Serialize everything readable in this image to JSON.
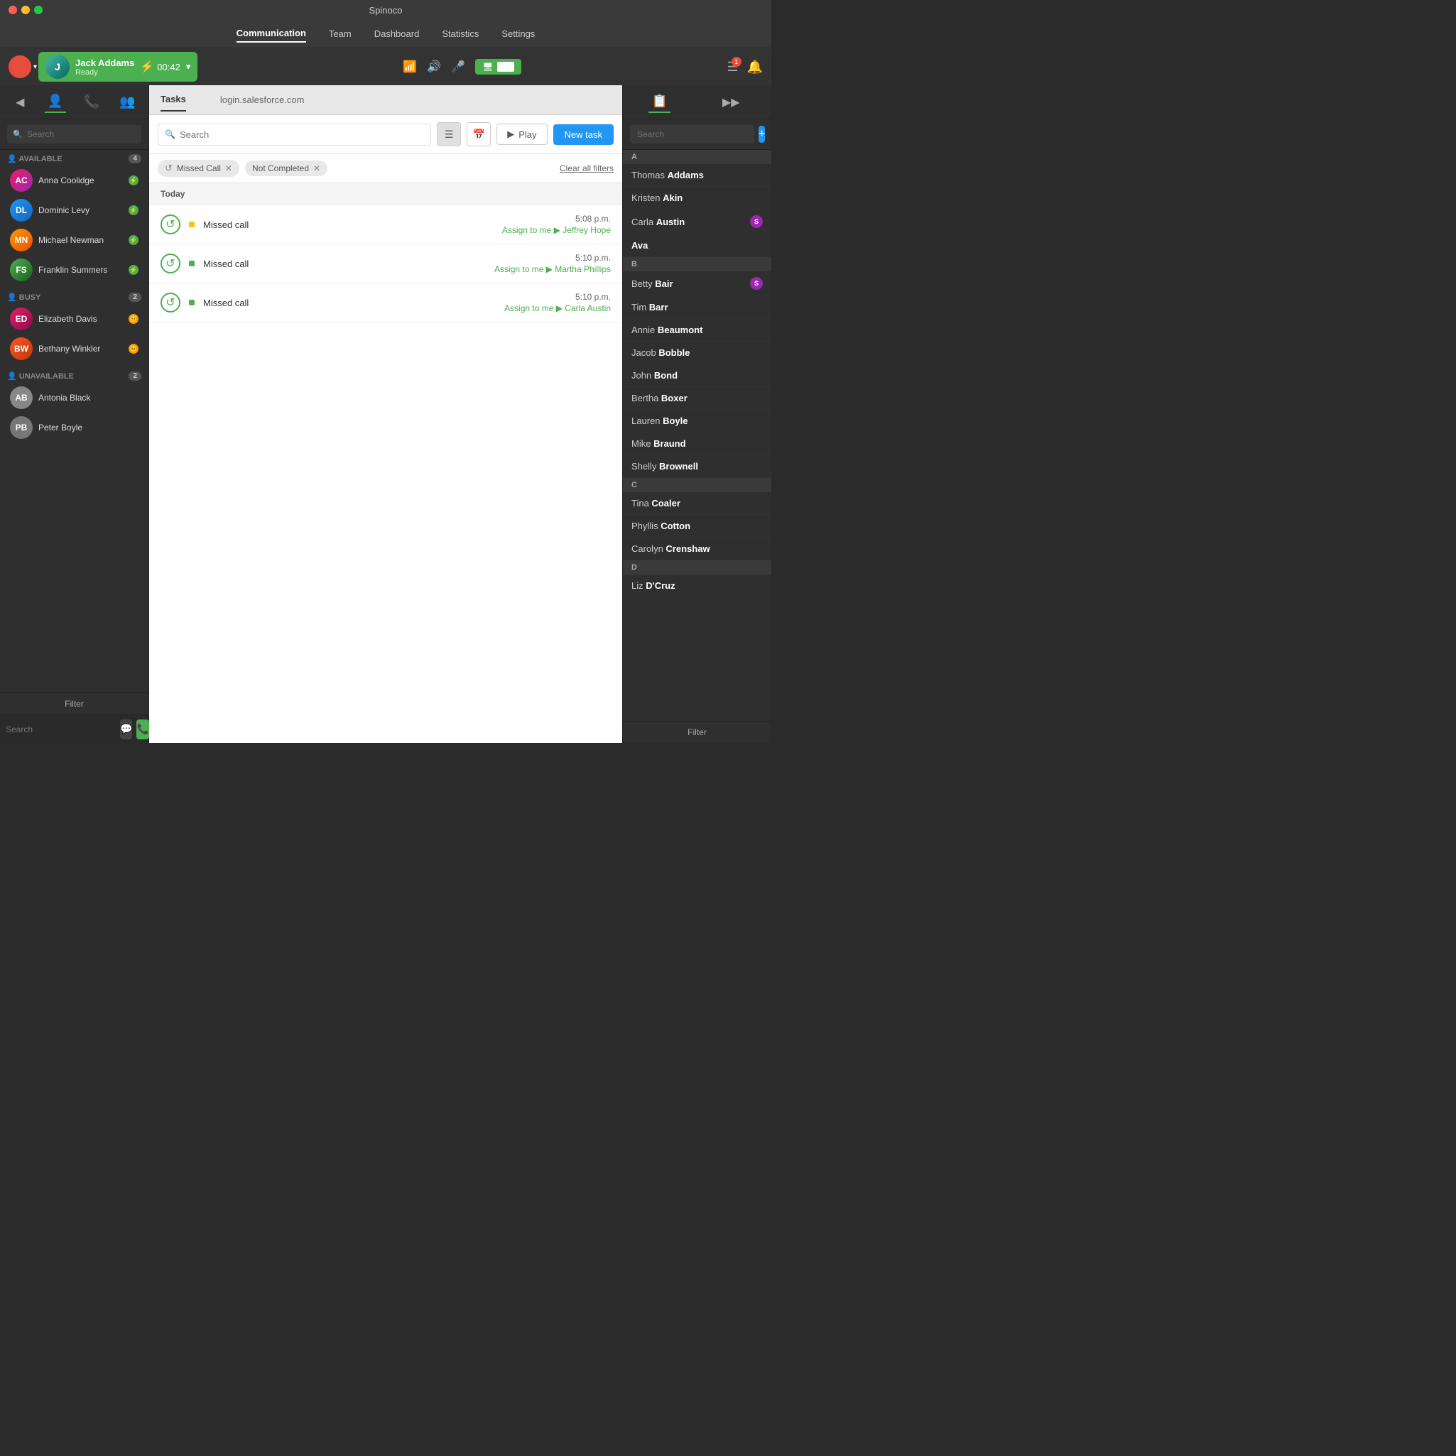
{
  "app": {
    "title": "Spinoco"
  },
  "titlebar": {
    "title": "Spinoco"
  },
  "navbar": {
    "items": [
      {
        "label": "Communication",
        "active": true
      },
      {
        "label": "Team",
        "active": false
      },
      {
        "label": "Dashboard",
        "active": false
      },
      {
        "label": "Statistics",
        "active": false
      },
      {
        "label": "Settings",
        "active": false
      }
    ]
  },
  "agentbar": {
    "agent_name": "Jack Addams",
    "agent_status": "Ready",
    "timer": "00:42"
  },
  "left_sidebar": {
    "search_placeholder": "Search",
    "groups": [
      {
        "label": "AVAILABLE",
        "count": 4,
        "agents": [
          {
            "name": "Anna Coolidge",
            "status": "available"
          },
          {
            "name": "Dominic Levy",
            "status": "available"
          },
          {
            "name": "Michael Newman",
            "status": "available"
          },
          {
            "name": "Franklin Summers",
            "status": "available"
          }
        ]
      },
      {
        "label": "BUSY",
        "count": 2,
        "agents": [
          {
            "name": "Elizabeth Davis",
            "status": "busy"
          },
          {
            "name": "Bethany Winkler",
            "status": "busy"
          }
        ]
      },
      {
        "label": "UNAVAILABLE",
        "count": 2,
        "agents": [
          {
            "name": "Antonia Black",
            "status": "unavailable"
          },
          {
            "name": "Peter Boyle",
            "status": "unavailable"
          }
        ]
      }
    ],
    "filter_label": "Filter"
  },
  "center_panel": {
    "tabs": [
      {
        "label": "Tasks",
        "active": true
      },
      {
        "label": "login.salesforce.com",
        "active": false
      }
    ],
    "search_placeholder": "Search",
    "buttons": {
      "play": "Play",
      "new_task": "New task"
    },
    "filters": [
      {
        "label": "Missed Call",
        "icon": "↺"
      },
      {
        "label": "Not Completed",
        "icon": ""
      }
    ],
    "clear_filters": "Clear all filters",
    "sections": [
      {
        "header": "Today",
        "tasks": [
          {
            "title": "Missed call",
            "time": "5:08 p.m.",
            "assign": "Assign to me",
            "person": "Jeffrey Hope",
            "dot_color": "#ffc107"
          },
          {
            "title": "Missed call",
            "time": "5:10 p.m.",
            "assign": "Assign to me",
            "person": "Martha Phillips",
            "dot_color": "#4caf50"
          },
          {
            "title": "Missed call",
            "time": "5:10 p.m.",
            "assign": "Assign to me",
            "person": "Carla Austin",
            "dot_color": "#4caf50"
          }
        ]
      }
    ]
  },
  "right_sidebar": {
    "search_placeholder": "Search",
    "sections": [
      {
        "header": "A",
        "contacts": [
          {
            "first": "Thomas",
            "last": "Addams"
          },
          {
            "first": "Kristen",
            "last": "Akin"
          },
          {
            "first": "Carla",
            "last": "Austin",
            "badge": "S"
          },
          {
            "first": "",
            "last": "Ava"
          }
        ]
      },
      {
        "header": "B",
        "contacts": [
          {
            "first": "Betty",
            "last": "Bair",
            "badge": "S"
          },
          {
            "first": "Tim",
            "last": "Barr"
          },
          {
            "first": "Annie",
            "last": "Beaumont"
          },
          {
            "first": "Jacob",
            "last": "Bobble"
          },
          {
            "first": "John",
            "last": "Bond"
          },
          {
            "first": "Bertha",
            "last": "Boxer"
          },
          {
            "first": "Lauren",
            "last": "Boyle"
          },
          {
            "first": "Mike",
            "last": "Braund"
          },
          {
            "first": "Shelly",
            "last": "Brownell"
          }
        ]
      },
      {
        "header": "C",
        "contacts": [
          {
            "first": "Tina",
            "last": "Coaler"
          },
          {
            "first": "Phyllis",
            "last": "Cotton"
          },
          {
            "first": "Carolyn",
            "last": "Crenshaw"
          }
        ]
      },
      {
        "header": "D",
        "contacts": [
          {
            "first": "Liz",
            "last": "D'Cruz"
          }
        ]
      }
    ],
    "filter_label": "Filter"
  }
}
